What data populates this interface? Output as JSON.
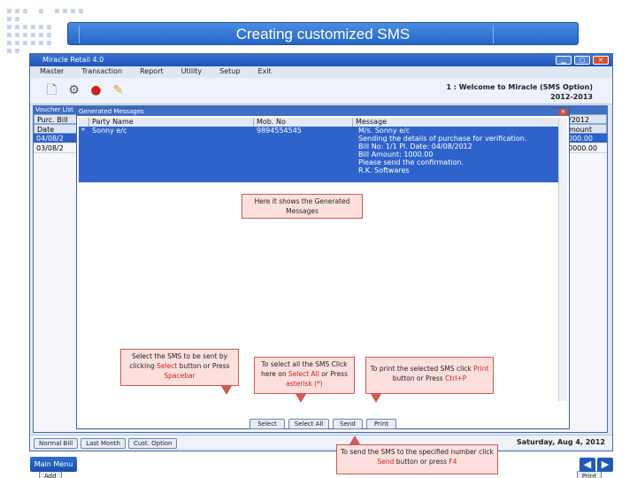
{
  "slide": {
    "title": "Creating customized SMS",
    "main_menu_label": "Main Menu",
    "prev_icon": "left-arrow-icon",
    "next_icon": "right-arrow-icon"
  },
  "window": {
    "title": "Miracle Retail 4.0",
    "menu": [
      "Master",
      "Transaction",
      "Report",
      "Utility",
      "Setup",
      "Exit"
    ],
    "welcome_line1": "1 : Welcome to Miracle (SMS Option)",
    "welcome_line2": "2012-2013",
    "status_buttons": [
      "Normal Bill",
      "Last Month",
      "Cust. Option"
    ],
    "status_date": "Saturday, Aug 4, 2012"
  },
  "voucher_list": {
    "title": "Voucher List",
    "left_header_1": "Purc. Bill",
    "left_header_2": "Date",
    "left_rows": [
      "04/08/2",
      "03/08/2"
    ],
    "right_header_1": "/2012",
    "right_header_2": "mount",
    "right_rows": [
      "000.00",
      "0000.00"
    ],
    "add_button": "Add",
    "print_button": "Print"
  },
  "generated_messages": {
    "title": "Generated Messages",
    "columns": [
      "Party Name",
      "Mob. No",
      "Message"
    ],
    "row": {
      "marker": "*",
      "party_name": "Sonny e/c",
      "mob_no": "9894554545",
      "message_lines": [
        "M/s. Sonny e/c",
        "Sending the details of purchase for verification.",
        "Bill No: 1/1 Pl. Date: 04/08/2012",
        "Bill Amount: 1000.00",
        "Please send the confirmation.",
        "R.K. Softwares"
      ]
    },
    "buttons": [
      "Select",
      "Select All",
      "Send",
      "Print"
    ]
  },
  "callouts": {
    "generated": "Here it shows the Generated Messages",
    "select_pre": "Select the SMS to be sent by clicking ",
    "select_hl1": "Select",
    "select_mid": " button or Press ",
    "select_hl2": "Spacebar",
    "selectall_pre": "To select all the SMS Click here on ",
    "selectall_hl1": "Select All",
    "selectall_mid": " or Press ",
    "selectall_hl2": "asterisk (*)",
    "print_pre": "To print the selected SMS click ",
    "print_hl1": "Print",
    "print_mid": " button or Press ",
    "print_hl2": "Ctrl+P",
    "send_pre": "To send the SMS to the specified number click ",
    "send_hl1": "Send",
    "send_mid": " button or press ",
    "send_hl2": "F4"
  },
  "colors": {
    "banner": "#2566c7",
    "selection": "#2f63cc",
    "callout_fill": "#fde0de",
    "callout_border": "#d15b50",
    "highlight_text": "#d51c1c"
  }
}
